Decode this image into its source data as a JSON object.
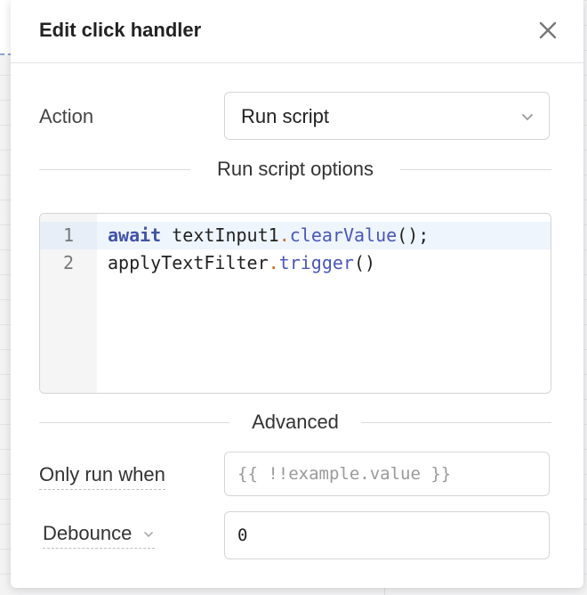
{
  "dialog": {
    "title": "Edit click handler",
    "close_icon": "close-icon"
  },
  "action": {
    "label": "Action",
    "selected": "Run script"
  },
  "script_options": {
    "heading": "Run script options",
    "lines": [
      {
        "number": "1",
        "keyword": "await",
        "object": "textInput1",
        "method": "clearValue",
        "suffix": "();"
      },
      {
        "number": "2",
        "object": "applyTextFilter",
        "method": "trigger",
        "suffix": "()"
      }
    ]
  },
  "advanced": {
    "heading": "Advanced",
    "only_run_when_label": "Only run when",
    "only_run_when_placeholder": "{{ !!example.value }}",
    "debounce_label": "Debounce",
    "debounce_value": "0"
  },
  "colors": {
    "keyword": "#4153a8",
    "method": "#4a57b8",
    "punct_dot": "#d46a1e",
    "active_line": "#eef5fd"
  }
}
